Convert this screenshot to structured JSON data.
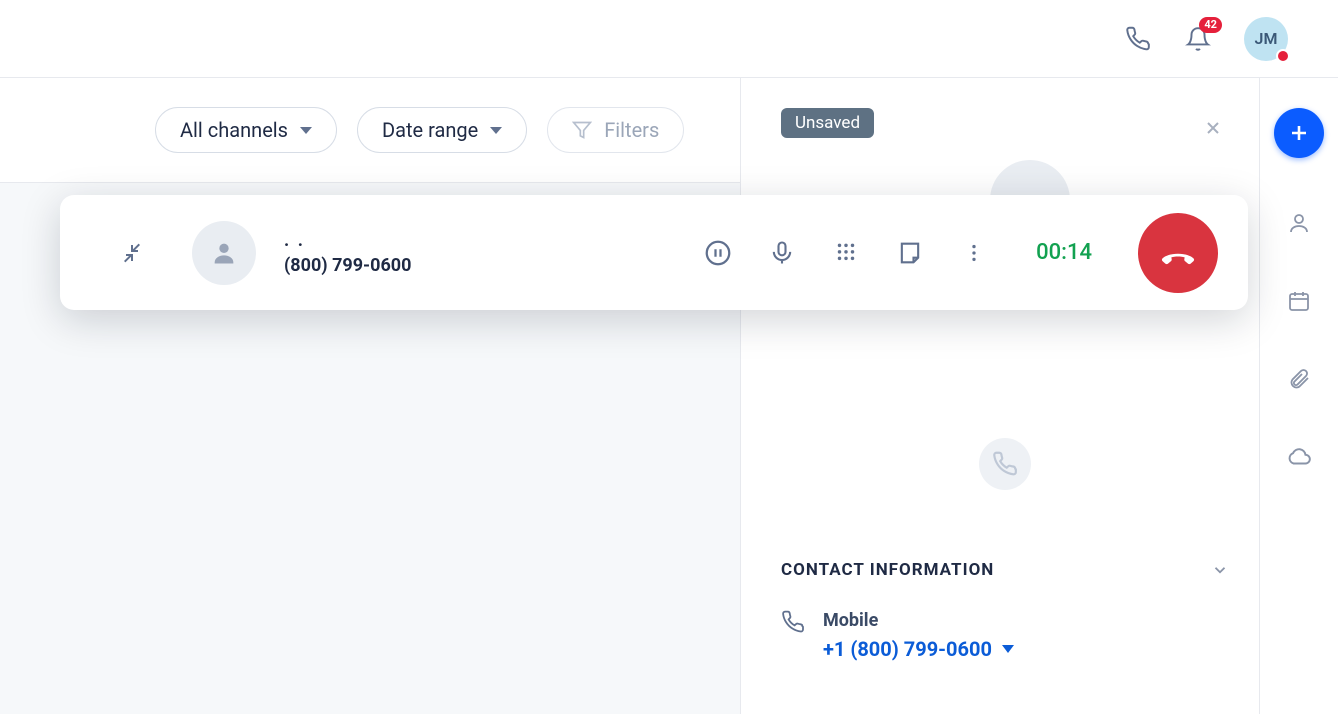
{
  "header": {
    "notification_count": "42",
    "avatar_initials": "JM"
  },
  "filters": {
    "channels_label": "All channels",
    "date_label": "Date range",
    "filters_label": "Filters"
  },
  "panel": {
    "status_badge": "Unsaved",
    "section_title": "CONTACT INFORMATION",
    "contact_type": "Mobile",
    "contact_number": "+1 (800) 799-0600"
  },
  "call": {
    "name": ". .",
    "number": "(800) 799-0600",
    "timer": "00:14"
  }
}
